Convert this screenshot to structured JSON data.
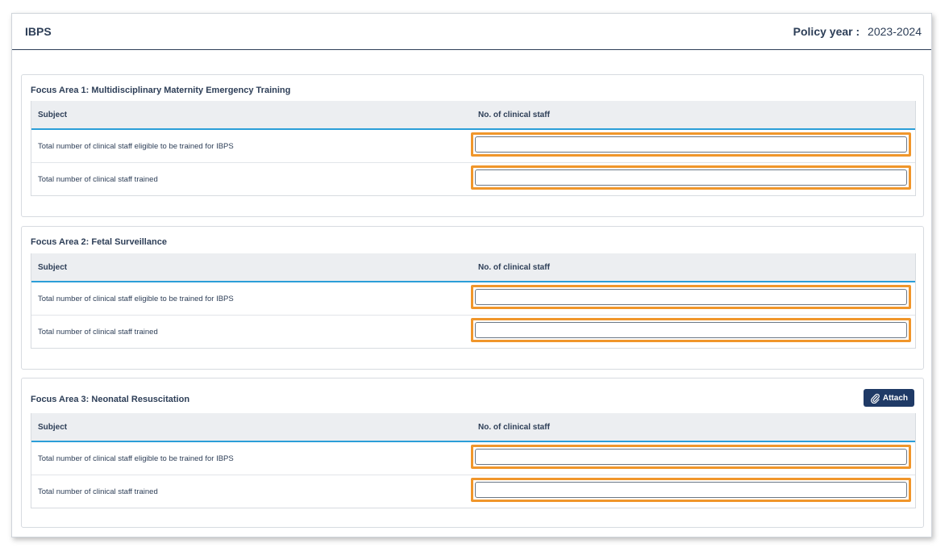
{
  "header": {
    "title": "IBPS",
    "policy_label": "Policy year :",
    "policy_value": "2023-2024"
  },
  "sections": [
    {
      "title": "Focus Area 1: Multidisciplinary Maternity Emergency Training",
      "col_subject": "Subject",
      "col_count": "No. of clinical staff",
      "rows": [
        {
          "label": "Total number of clinical staff eligible to be trained for IBPS",
          "value": ""
        },
        {
          "label": "Total number of clinical staff trained",
          "value": ""
        }
      ]
    },
    {
      "title": "Focus Area 2: Fetal Surveillance",
      "col_subject": "Subject",
      "col_count": "No. of clinical staff",
      "rows": [
        {
          "label": "Total number of clinical staff eligible to be trained for IBPS",
          "value": ""
        },
        {
          "label": "Total number of clinical staff trained",
          "value": ""
        }
      ]
    },
    {
      "title": "Focus Area 3: Neonatal Resuscitation",
      "attach_label": "Attach",
      "col_subject": "Subject",
      "col_count": "No. of clinical staff",
      "rows": [
        {
          "label": "Total number of clinical staff eligible to be trained for IBPS",
          "value": ""
        },
        {
          "label": "Total number of clinical staff trained",
          "value": ""
        }
      ]
    }
  ],
  "icons": {
    "attach": "paperclip-icon"
  },
  "colors": {
    "highlight": "#f0962b",
    "accent": "#2b9ed8",
    "button": "#1f3a66"
  }
}
